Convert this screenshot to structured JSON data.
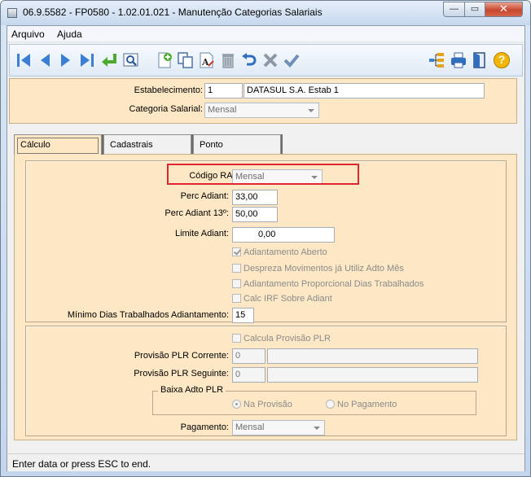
{
  "window": {
    "title": "06.9.5582 - FP0580 - 1.02.01.021 - Manutenção Categorias Salariais",
    "minimize_glyph": "—",
    "maximize_glyph": "▭",
    "close_glyph": "✕"
  },
  "menubar": {
    "items": [
      {
        "label": "Arquivo"
      },
      {
        "label": "Ajuda"
      }
    ]
  },
  "toolbar": {
    "icons": [
      "first-record-icon",
      "previous-record-icon",
      "next-record-icon",
      "last-record-icon",
      "go-to-icon",
      "search-icon",
      "new-record-icon",
      "copy-icon",
      "edit-icon",
      "delete-icon",
      "undo-icon",
      "cancel-icon",
      "save-icon",
      "tree-view-icon",
      "print-icon",
      "exit-icon",
      "help-icon"
    ],
    "help_glyph": "?"
  },
  "header": {
    "estabelecimento_label": "Estabelecimento:",
    "estabelecimento_code": "1",
    "estabelecimento_name": "DATASUL S.A. Estab 1",
    "categoria_label": "Categoria Salarial:",
    "categoria_value": "Mensal"
  },
  "tabs": [
    {
      "label": "Cálculo",
      "active": true
    },
    {
      "label": "Cadastrais"
    },
    {
      "label": "Ponto"
    }
  ],
  "calculo": {
    "codigo_rais_label": "Código RAIS:",
    "codigo_rais_value": "Mensal",
    "perc_adiant_label": "Perc Adiant:",
    "perc_adiant_value": "33,00",
    "perc_adiant_13_label": "Perc Adiant 13º:",
    "perc_adiant_13_value": "50,00",
    "limite_adiant_label": "Limite Adiant:",
    "limite_adiant_value": "0,00",
    "checkboxes": [
      {
        "label": "Adiantamento Aberto",
        "checked": true
      },
      {
        "label": "Despreza Movimentos já Utiliz Adto Mês",
        "checked": false
      },
      {
        "label": "Adiantamento Proporcional Dias Trabalhados",
        "checked": false
      },
      {
        "label": "Calc IRF Sobre Adiant",
        "checked": false
      }
    ],
    "minimo_dias_label": "Mínimo Dias Trabalhados Adiantamento:",
    "minimo_dias_value": "15"
  },
  "plr": {
    "calcula_label": "Calcula Provisão PLR",
    "corrente_label": "Provisão PLR Corrente:",
    "corrente_value": "0",
    "corrente_desc": "",
    "seguinte_label": "Provisão PLR Seguinte:",
    "seguinte_value": "0",
    "seguinte_desc": "",
    "baixa_title": "Baixa Adto PLR",
    "na_provisao_label": "Na Provisão",
    "no_pagamento_label": "No Pagamento",
    "pagamento_label": "Pagamento:",
    "pagamento_value": "Mensal"
  },
  "status": {
    "text": "Enter data or press ESC to end."
  }
}
